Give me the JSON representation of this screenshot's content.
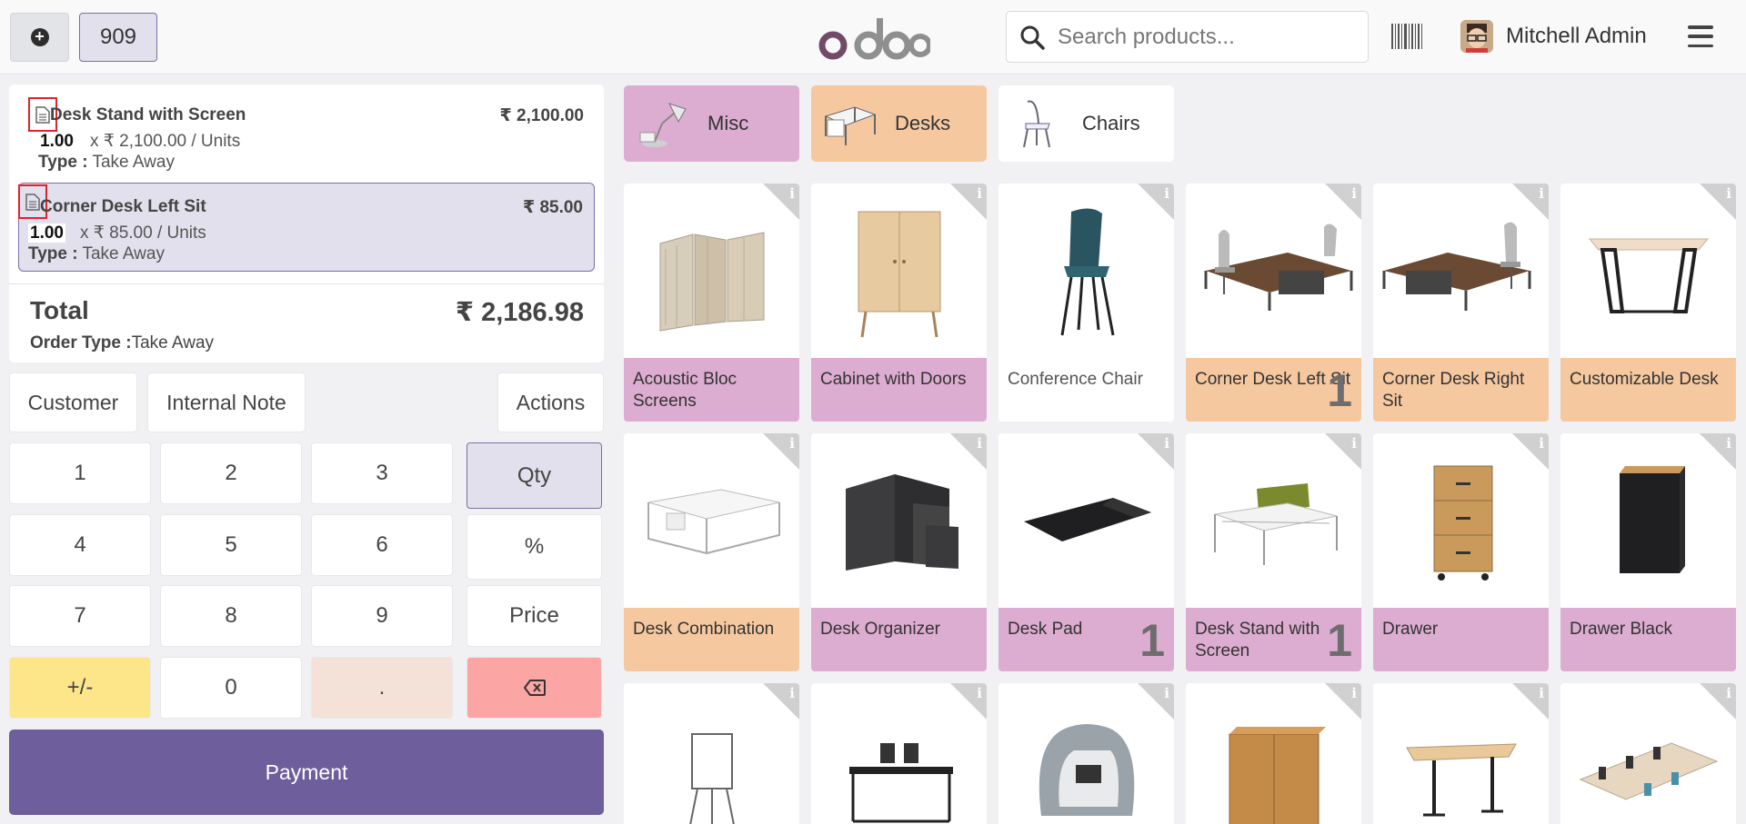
{
  "header": {
    "order_number": "909",
    "search_placeholder": "Search products...",
    "user_name": "Mitchell Admin"
  },
  "order": {
    "lines": [
      {
        "name": "Desk Stand with Screen",
        "price": "₹ 2,100.00",
        "qty": "1.00",
        "unit_price": "x ₹ 2,100.00 / Units",
        "type_label": "Type :",
        "type_value": "Take Away"
      },
      {
        "name": "Corner Desk Left Sit",
        "price": "₹ 85.00",
        "qty": "1.00",
        "unit_price": "x ₹ 85.00 / Units",
        "type_label": "Type :",
        "type_value": "Take Away"
      }
    ],
    "total_label": "Total",
    "total_value": "₹ 2,186.98",
    "order_type_label": "Order Type :",
    "order_type_value": "Take Away"
  },
  "controls": {
    "customer": "Customer",
    "internal_note": "Internal Note",
    "actions": "Actions"
  },
  "numpad": {
    "k1": "1",
    "k2": "2",
    "k3": "3",
    "k4": "4",
    "k5": "5",
    "k6": "6",
    "k7": "7",
    "k8": "8",
    "k9": "9",
    "k0": "0",
    "sign": "+/-",
    "dot": ".",
    "qty": "Qty",
    "pct": "%",
    "price": "Price"
  },
  "payment_label": "Payment",
  "categories": [
    {
      "name": "Misc",
      "color": "#dcadd0"
    },
    {
      "name": "Desks",
      "color": "#f6c8a0"
    },
    {
      "name": "Chairs",
      "color": "#ffffff"
    }
  ],
  "products": [
    {
      "name": "Acoustic Bloc Screens",
      "qty": ""
    },
    {
      "name": "Cabinet with Doors",
      "qty": ""
    },
    {
      "name": "Conference Chair",
      "qty": ""
    },
    {
      "name": "Corner Desk Left Sit",
      "qty": "1"
    },
    {
      "name": "Corner Desk Right Sit",
      "qty": ""
    },
    {
      "name": "Customizable Desk",
      "qty": ""
    },
    {
      "name": "Desk Combination",
      "qty": ""
    },
    {
      "name": "Desk Organizer",
      "qty": ""
    },
    {
      "name": "Desk Pad",
      "qty": "1"
    },
    {
      "name": "Desk Stand with Screen",
      "qty": "1"
    },
    {
      "name": "Drawer",
      "qty": ""
    },
    {
      "name": "Drawer Black",
      "qty": ""
    }
  ],
  "colors": {
    "accent": "#6e5e9c",
    "misc": "#dcadd0",
    "desks": "#f6c8a0",
    "sign_key": "#fde68a",
    "dot_key": "#f4e2d8",
    "backspace_key": "#fca5a5"
  }
}
